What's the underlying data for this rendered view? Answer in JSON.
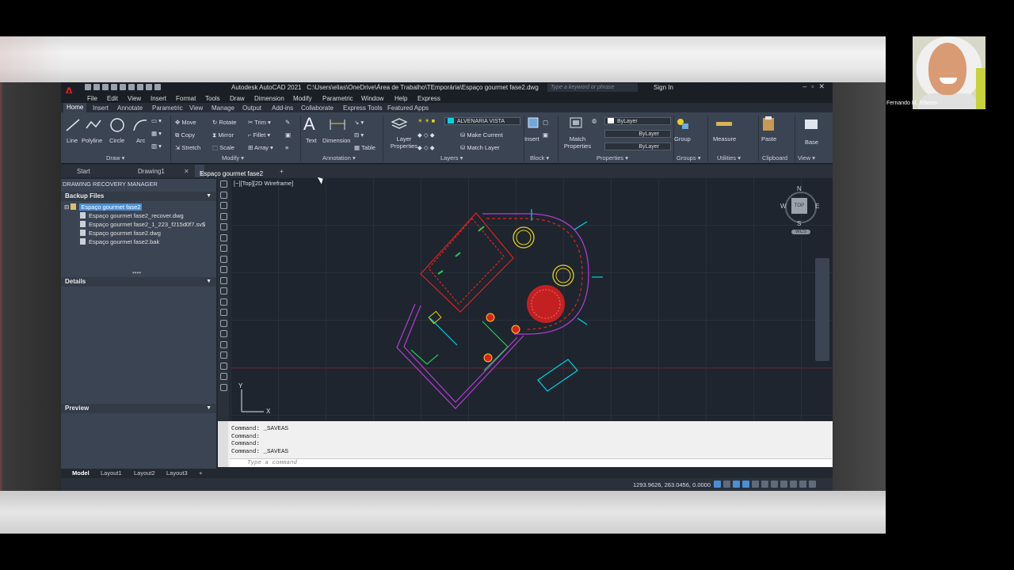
{
  "webcam": {
    "participant_name": "Fernando M. Ribeiro"
  },
  "app": {
    "title": "Autodesk AutoCAD 2021",
    "file_path": "C:\\Users\\elias\\OneDrive\\Área de Trabalho\\TEmporária\\Espaço gourmet fase2.dwg",
    "search_placeholder": "Type a keyword or phrase",
    "sign_in": "Sign In"
  },
  "menu": [
    "File",
    "Edit",
    "View",
    "Insert",
    "Format",
    "Tools",
    "Draw",
    "Dimension",
    "Modify",
    "Parametric",
    "Window",
    "Help",
    "Express"
  ],
  "ribbon_tabs": [
    "Home",
    "Insert",
    "Annotate",
    "Parametric",
    "View",
    "Manage",
    "Output",
    "Add-ins",
    "Collaborate",
    "Express Tools",
    "Featured Apps"
  ],
  "ribbon": {
    "draw": {
      "line": "Line",
      "polyline": "Polyline",
      "circle": "Circle",
      "arc": "Arc",
      "panel": "Draw"
    },
    "modify": {
      "move": "Move",
      "rotate": "Rotate",
      "trim": "Trim",
      "copy": "Copy",
      "mirror": "Mirror",
      "fillet": "Fillet",
      "stretch": "Stretch",
      "scale": "Scale",
      "array": "Array",
      "panel": "Modify"
    },
    "annotation": {
      "text": "Text",
      "dimension": "Dimension",
      "table": "Table",
      "panel": "Annotation"
    },
    "layers": {
      "layer_properties": "Layer Properties",
      "current_layer": "ALVENARIA VISTA",
      "make_current": "Make Current",
      "match_layer": "Match Layer",
      "panel": "Layers"
    },
    "block": {
      "insert": "Insert",
      "panel": "Block"
    },
    "properties": {
      "match_properties": "Match Properties",
      "color": "ByLayer",
      "linetype": "ByLayer",
      "lineweight": "ByLayer",
      "panel": "Properties"
    },
    "groups": {
      "group": "Group",
      "panel": "Groups"
    },
    "utilities": {
      "measure": "Measure",
      "panel": "Utilities"
    },
    "clipboard": {
      "paste": "Paste",
      "panel": "Clipboard"
    },
    "view": {
      "base": "Base",
      "panel": "View"
    }
  },
  "file_tabs": [
    "Start",
    "Drawing1",
    "Espaço gourmet fase2"
  ],
  "recovery": {
    "title": "DRAWING RECOVERY MANAGER",
    "backup_header": "Backup Files",
    "root": "Espaço gourmet fase2",
    "files": [
      "Espaço gourmet fase2_recover.dwg",
      "Espaço gourmet fase2_1_223_f215d0f7.sv$",
      "Espaço gourmet fase2.dwg",
      "Espaço gourmet fase2.bak"
    ],
    "details_header": "Details",
    "preview_header": "Preview"
  },
  "viewport": {
    "label": "[−][Top][2D Wireframe]",
    "compass": {
      "n": "N",
      "s": "S",
      "e": "E",
      "w": "W",
      "top": "TOP",
      "wcs": "WCS"
    },
    "ucs": {
      "x": "X",
      "y": "Y"
    }
  },
  "command": {
    "lines": [
      "Command:  _SAVEAS",
      "Command:",
      "Command:",
      "Command:  _SAVEAS"
    ],
    "placeholder": "Type a command"
  },
  "layouts": [
    "Model",
    "Layout1",
    "Layout2",
    "Layout3"
  ],
  "status": {
    "coordinates": "1293.9626, 263.0456, 0.0000"
  },
  "colors": {
    "accent": "#4a8fd6",
    "layer_cyan": "#00d5e0",
    "wall_magenta": "#b43cd6",
    "furniture_red": "#e02020",
    "furniture_yellow": "#e6d21a",
    "brand_red": "#e0201a"
  }
}
